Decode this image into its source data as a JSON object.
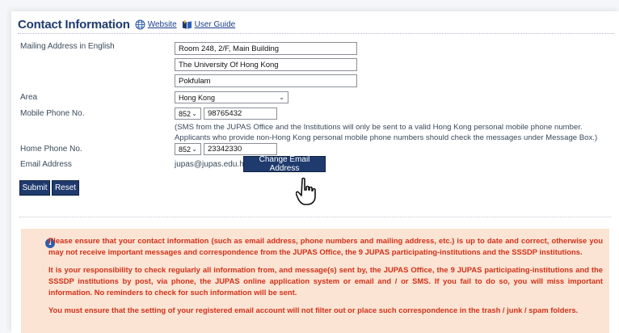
{
  "header": {
    "title": "Contact Information",
    "website_label": "Website",
    "user_guide_label": "User Guide"
  },
  "form": {
    "mailing_label": "Mailing Address in English",
    "address_line1": "Room 248, 2/F, Main Building",
    "address_line2": "The University Of Hong Kong",
    "address_line3": "Pokfulam",
    "area_label": "Area",
    "area_value": "Hong Kong",
    "mobile_label": "Mobile Phone No.",
    "mobile_code": "852",
    "mobile_number": "98765432",
    "mobile_note": "(SMS from the JUPAS Office and the Institutions will only be sent to a valid Hong Kong personal mobile phone number. Applicants who provide non-Hong Kong personal mobile phone numbers should check the messages under Message Box.)",
    "home_label": "Home Phone No.",
    "home_code": "852",
    "home_number": "23342330",
    "email_label": "Email Address",
    "email_value": "jupas@jupas.edu.hk",
    "change_email_label": "Change Email Address",
    "submit_label": "Submit",
    "reset_label": "Reset"
  },
  "notice": {
    "icon": "info-icon",
    "para1": "Please ensure that your contact information (such as email address, phone numbers and mailing address, etc.) is up to date and correct, otherwise you may not receive important messages and correspondence from the JUPAS Office, the 9 JUPAS participating-institutions and the SSSDP institutions.",
    "para2": "It is your responsibility to check regularly all information from, and message(s) sent by, the JUPAS Office, the 9 JUPAS participating-institutions and the SSSDP institutions by post, via phone, the JUPAS online application system or email and / or SMS. If you fail to do so, you will miss important information. No reminders to check for such information will be sent.",
    "para3": "You must ensure that the setting of your registered email account will not filter out or place such correspondence in the trash / junk / spam folders."
  },
  "colors": {
    "accent": "#1f3b6e",
    "notice_bg": "#fbe4d3",
    "notice_text": "#d2311a"
  }
}
